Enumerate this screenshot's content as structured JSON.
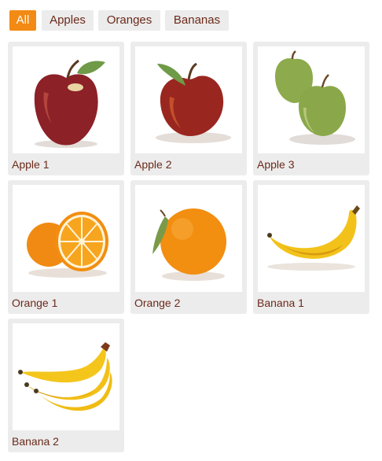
{
  "filters": [
    {
      "label": "All",
      "active": true
    },
    {
      "label": "Apples",
      "active": false
    },
    {
      "label": "Oranges",
      "active": false
    },
    {
      "label": "Bananas",
      "active": false
    }
  ],
  "gallery": {
    "items": [
      {
        "caption": "Apple 1",
        "icon": "red-apple-icon"
      },
      {
        "caption": "Apple 2",
        "icon": "red-apple-leaf-icon"
      },
      {
        "caption": "Apple 3",
        "icon": "green-apples-icon"
      },
      {
        "caption": "Orange 1",
        "icon": "orange-halves-icon"
      },
      {
        "caption": "Orange 2",
        "icon": "whole-orange-icon"
      },
      {
        "caption": "Banana 1",
        "icon": "banana-icon"
      },
      {
        "caption": "Banana 2",
        "icon": "banana-bunch-icon"
      }
    ]
  },
  "colors": {
    "accent": "#f28a14",
    "button_bg": "#ececec",
    "text": "#6b2a1a",
    "card_bg": "#ececec"
  }
}
